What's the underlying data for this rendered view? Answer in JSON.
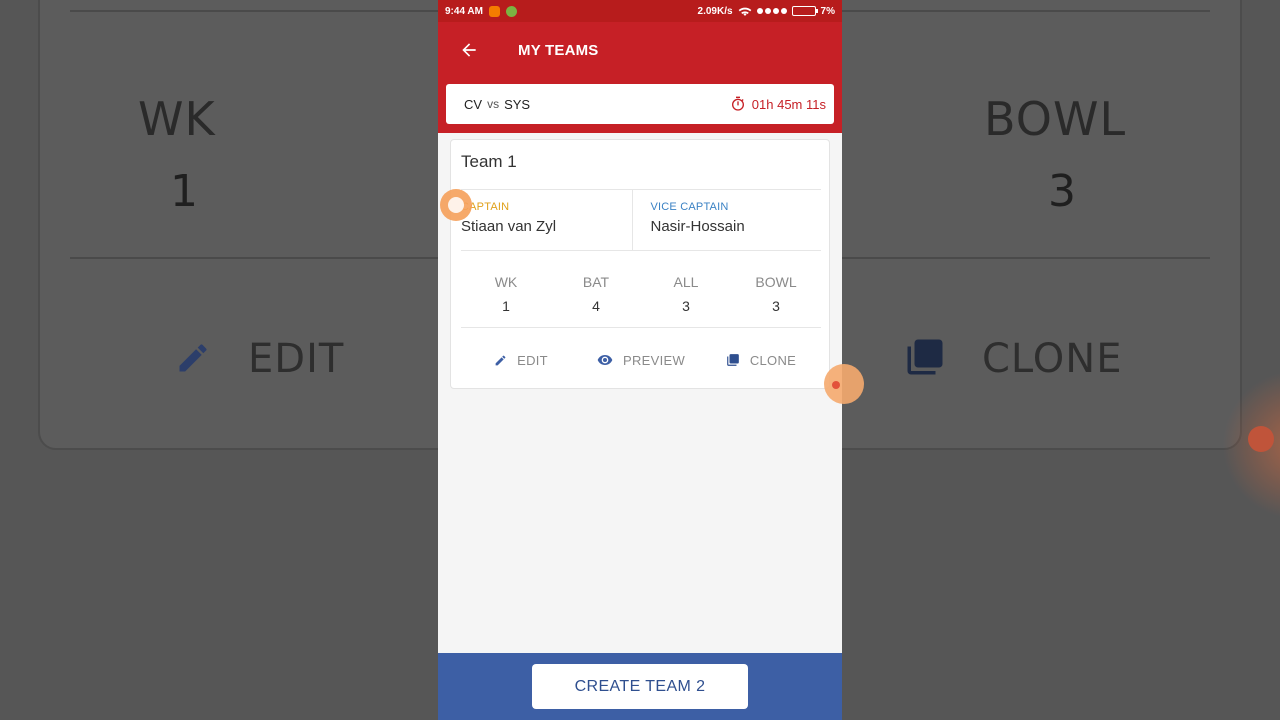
{
  "status_bar": {
    "time": "9:44 AM",
    "network_speed": "2.09K/s",
    "battery": "7%"
  },
  "app_bar": {
    "title": "MY TEAMS",
    "back_icon": "arrow-left-icon"
  },
  "match": {
    "team1": "CV",
    "vs": "vs",
    "team2": "SYS",
    "countdown": "01h 45m 11s",
    "timer_icon": "stopwatch-icon"
  },
  "team_card": {
    "title": "Team 1",
    "captain_label": "CAPTAIN",
    "captain_name": "Stiaan van Zyl",
    "vice_captain_label": "VICE CAPTAIN",
    "vice_captain_name": "Nasir-Hossain",
    "stats": [
      {
        "label": "WK",
        "value": "1"
      },
      {
        "label": "BAT",
        "value": "4"
      },
      {
        "label": "ALL",
        "value": "3"
      },
      {
        "label": "BOWL",
        "value": "3"
      }
    ],
    "actions": [
      {
        "label": "EDIT",
        "icon": "pencil-icon"
      },
      {
        "label": "PREVIEW",
        "icon": "eye-icon"
      },
      {
        "label": "CLONE",
        "icon": "copy-icon"
      }
    ]
  },
  "bottom": {
    "create_button": "CREATE TEAM 2"
  },
  "colors": {
    "header_red": "#c62026",
    "status_red": "#b71c1c",
    "captain": "#e0a11b",
    "vice_captain": "#3b82c4",
    "bottom_blue": "#3d5fa5",
    "button_text": "#2f4f8f"
  }
}
